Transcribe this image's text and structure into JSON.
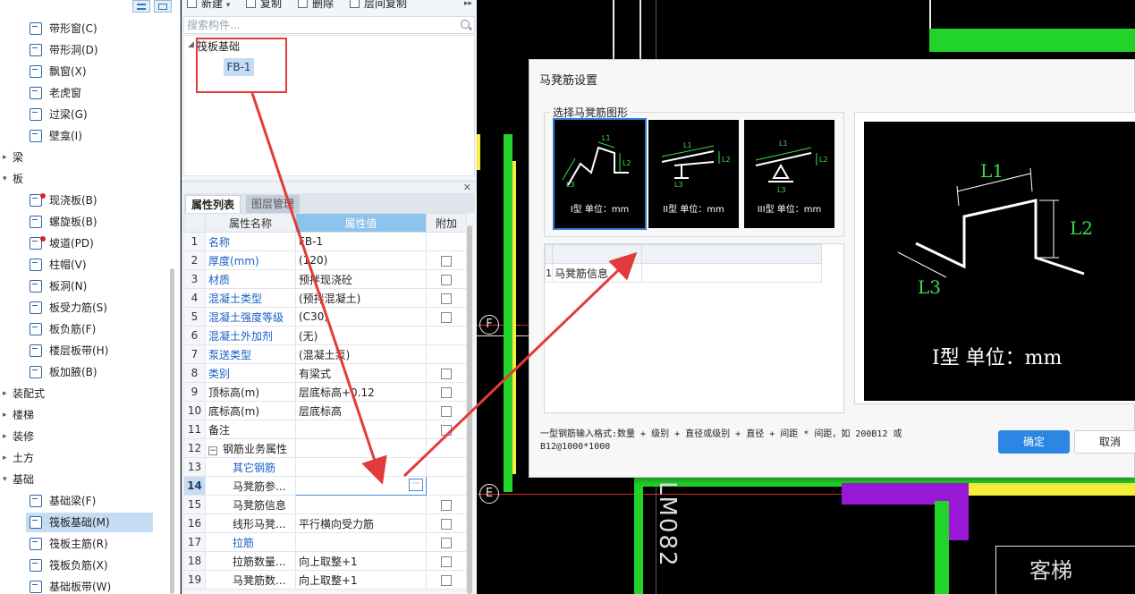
{
  "tree": {
    "items": [
      {
        "label": "带形窗(C)",
        "type": "item"
      },
      {
        "label": "带形洞(D)",
        "type": "item"
      },
      {
        "label": "飘窗(X)",
        "type": "item"
      },
      {
        "label": "老虎窗",
        "type": "item"
      },
      {
        "label": "过梁(G)",
        "type": "item"
      },
      {
        "label": "壁龛(I)",
        "type": "item"
      },
      {
        "label": "梁",
        "type": "group",
        "arrow": "▸"
      },
      {
        "label": "板",
        "type": "group",
        "arrow": "▾"
      },
      {
        "label": "现浇板(B)",
        "type": "item",
        "dot": true
      },
      {
        "label": "螺旋板(B)",
        "type": "item"
      },
      {
        "label": "坡道(PD)",
        "type": "item",
        "dot": true
      },
      {
        "label": "柱帽(V)",
        "type": "item"
      },
      {
        "label": "板洞(N)",
        "type": "item"
      },
      {
        "label": "板受力筋(S)",
        "type": "item"
      },
      {
        "label": "板负筋(F)",
        "type": "item"
      },
      {
        "label": "楼层板带(H)",
        "type": "item"
      },
      {
        "label": "板加腋(B)",
        "type": "item"
      },
      {
        "label": "装配式",
        "type": "group",
        "arrow": "▸"
      },
      {
        "label": "楼梯",
        "type": "group",
        "arrow": "▸"
      },
      {
        "label": "装修",
        "type": "group",
        "arrow": "▸"
      },
      {
        "label": "土方",
        "type": "group",
        "arrow": "▸"
      },
      {
        "label": "基础",
        "type": "group",
        "arrow": "▾"
      },
      {
        "label": "基础梁(F)",
        "type": "item"
      },
      {
        "label": "筏板基础(M)",
        "type": "item",
        "selected": true
      },
      {
        "label": "筏板主筋(R)",
        "type": "item"
      },
      {
        "label": "筏板负筋(X)",
        "type": "item"
      },
      {
        "label": "基础板带(W)",
        "type": "item"
      }
    ]
  },
  "toolbar": {
    "new_label": "新建",
    "copy_label": "复制",
    "delete_label": "删除",
    "floor_copy_label": "层间复制",
    "dropdown_icon": "▾",
    "more_icon": "▸▸"
  },
  "search": {
    "placeholder": "搜索构件..."
  },
  "components": {
    "root_label": "筏板基础",
    "root_arrow": "◢",
    "child_label": "FB-1"
  },
  "panel_close_icon": "✕",
  "props": {
    "tab_active": "属性列表",
    "tab_inactive": "图层管理",
    "headers": {
      "name": "属性名称",
      "value": "属性值",
      "attach": "附加"
    },
    "rows": [
      {
        "n": "1",
        "name": "名称",
        "value": "FB-1",
        "cb": false,
        "blue": true
      },
      {
        "n": "2",
        "name": "厚度(mm)",
        "value": "(120)",
        "cb": true,
        "blue": true
      },
      {
        "n": "3",
        "name": "材质",
        "value": "预拌现浇砼",
        "cb": true,
        "blue": true
      },
      {
        "n": "4",
        "name": "混凝土类型",
        "value": "(预拌混凝土)",
        "cb": true,
        "blue": true
      },
      {
        "n": "5",
        "name": "混凝土强度等级",
        "value": "(C30)",
        "cb": true,
        "blue": true
      },
      {
        "n": "6",
        "name": "混凝土外加剂",
        "value": "(无)",
        "cb": false,
        "blue": true
      },
      {
        "n": "7",
        "name": "泵送类型",
        "value": "(混凝土泵)",
        "cb": false,
        "blue": true
      },
      {
        "n": "8",
        "name": "类别",
        "value": "有梁式",
        "cb": true,
        "blue": true
      },
      {
        "n": "9",
        "name": "顶标高(m)",
        "value": "层底标高+0.12",
        "cb": true,
        "blue": false
      },
      {
        "n": "10",
        "name": "底标高(m)",
        "value": "层底标高",
        "cb": true,
        "blue": false
      },
      {
        "n": "11",
        "name": "备注",
        "value": "",
        "cb": true,
        "blue": false
      },
      {
        "n": "12",
        "name": "钢筋业务属性",
        "value": "",
        "cb": false,
        "blue": false,
        "group": true
      },
      {
        "n": "13",
        "name": "其它钢筋",
        "value": "",
        "cb": false,
        "blue": true,
        "indent": true
      },
      {
        "n": "14",
        "name": "马凳筋参...",
        "value": "",
        "cb": false,
        "blue": false,
        "indent": true,
        "editing": true
      },
      {
        "n": "15",
        "name": "马凳筋信息",
        "value": "",
        "cb": true,
        "blue": false,
        "indent": true
      },
      {
        "n": "16",
        "name": "线形马凳...",
        "value": "平行横向受力筋",
        "cb": true,
        "blue": false,
        "indent": true
      },
      {
        "n": "17",
        "name": "拉筋",
        "value": "",
        "cb": true,
        "blue": true,
        "indent": true
      },
      {
        "n": "18",
        "name": "拉筋数量...",
        "value": "向上取整+1",
        "cb": true,
        "blue": false,
        "indent": true
      },
      {
        "n": "19",
        "name": "马凳筋数...",
        "value": "向上取整+1",
        "cb": true,
        "blue": false,
        "indent": true
      }
    ],
    "group_toggle": "−",
    "ellipsis": "···"
  },
  "cad": {
    "axis_f": "F",
    "axis_e": "E",
    "room_label": "客梯",
    "wall_label": "LM082"
  },
  "dialog": {
    "title": "马凳筋设置",
    "group_label": "选择马凳筋图形",
    "shapes": [
      {
        "caption": "I型 单位：mm",
        "l1": "L1",
        "l2": "L2",
        "l3": "L3"
      },
      {
        "caption": "II型 单位：mm",
        "l1": "L1",
        "l2": "L2",
        "l3": "L3"
      },
      {
        "caption": "III型 单位：mm",
        "l1": "L1",
        "l2": "L2",
        "l3": "L3"
      }
    ],
    "preview": {
      "caption": "I型 单位：mm",
      "l1": "L1",
      "l2": "L2",
      "l3": "L3"
    },
    "info_row": {
      "n": "1",
      "label": "马凳筋信息",
      "value": ""
    },
    "format_hint": "一型钢筋输入格式:数量 + 级别 + 直径或级别 + 直径 + 间距 * 间距，如 200B12 或 B12@1000*1000",
    "ok_label": "确定",
    "cancel_label": "取消"
  },
  "colors": {
    "annotation_red": "#e23b3b",
    "accent_blue": "#2d86e3",
    "cad_green": "#22d32a",
    "cad_yellow": "#f5ee3a",
    "cad_purple": "#9a19d6",
    "dim_green": "#35e04a"
  }
}
